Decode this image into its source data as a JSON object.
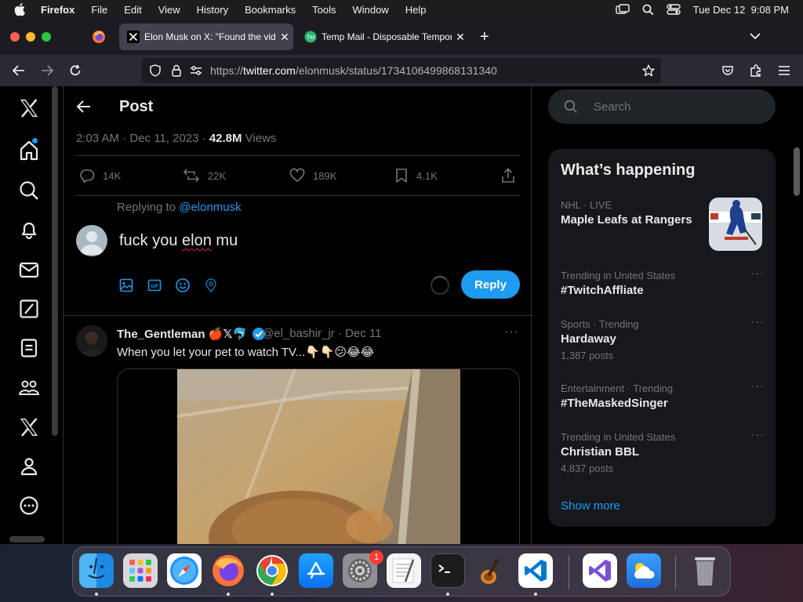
{
  "menubar": {
    "app": "Firefox",
    "items": [
      "File",
      "Edit",
      "View",
      "History",
      "Bookmarks",
      "Tools",
      "Window",
      "Help"
    ],
    "datetime": "Tue Dec 12  9:08 PM"
  },
  "browser": {
    "tabs": [
      {
        "title": "Elon Musk on X: \"Found the vide",
        "active": true
      },
      {
        "title": "Temp Mail - Disposable Tempor",
        "active": false
      }
    ],
    "new_tab": "+",
    "url_prefix": "https://",
    "url_host": "twitter.com",
    "url_path": "/elonmusk/status/1734106499868131340"
  },
  "x_nav": {
    "icons": [
      "x-logo-icon",
      "home-icon",
      "explore-icon",
      "notifications-icon",
      "messages-icon",
      "grok-icon",
      "lists-icon",
      "communities-icon",
      "premium-icon",
      "profile-icon",
      "more-icon"
    ]
  },
  "post": {
    "header_title": "Post",
    "time": "2:03 AM · Dec 11, 2023 · ",
    "views_count": "42.8M",
    "views_label": " Views",
    "replies": "14K",
    "reposts": "22K",
    "likes": "189K",
    "bookmarks": "4.1K"
  },
  "composer": {
    "replying_prefix": "Replying to ",
    "replying_handle": "@elonmusk",
    "text_before": "fuck you ",
    "text_typo": "elon",
    "text_after": " mu",
    "reply_label": "Reply"
  },
  "reply_tweet": {
    "display_name": "The_Gentleman 🍎𝕏🐬",
    "handle_date": "@el_bashir_jr · Dec 11",
    "more": "···",
    "text": "When you let your pet to watch TV...👇🏻👇🏻😕😂😂"
  },
  "sidebar": {
    "search_placeholder": "Search",
    "heading": "What’s happening",
    "trends": [
      {
        "meta": "NHL · LIVE",
        "name": "Maple Leafs at Rangers",
        "posts": ""
      },
      {
        "meta": "Trending in United States",
        "name": "#TwitchAffliate",
        "posts": ""
      },
      {
        "meta": "Sports · Trending",
        "name": "Hardaway",
        "posts": "1,387 posts"
      },
      {
        "meta": "Entertainment · Trending",
        "name": "#TheMaskedSinger",
        "posts": ""
      },
      {
        "meta": "Trending in United States",
        "name": "Christian BBL",
        "posts": "4,837 posts"
      }
    ],
    "show_more": "Show more"
  },
  "dock": {
    "apps": [
      "Finder",
      "Launchpad",
      "Safari",
      "Firefox",
      "Chrome",
      "App Store",
      "System Settings",
      "TextEdit",
      "Terminal",
      "GarageBand",
      "Visual Studio Code",
      "Visual Studio",
      "Weather",
      "Trash"
    ],
    "settings_badge": "1"
  },
  "colors": {
    "accent": "#1d9bf0",
    "background": "#000000",
    "muted": "#71767b"
  }
}
